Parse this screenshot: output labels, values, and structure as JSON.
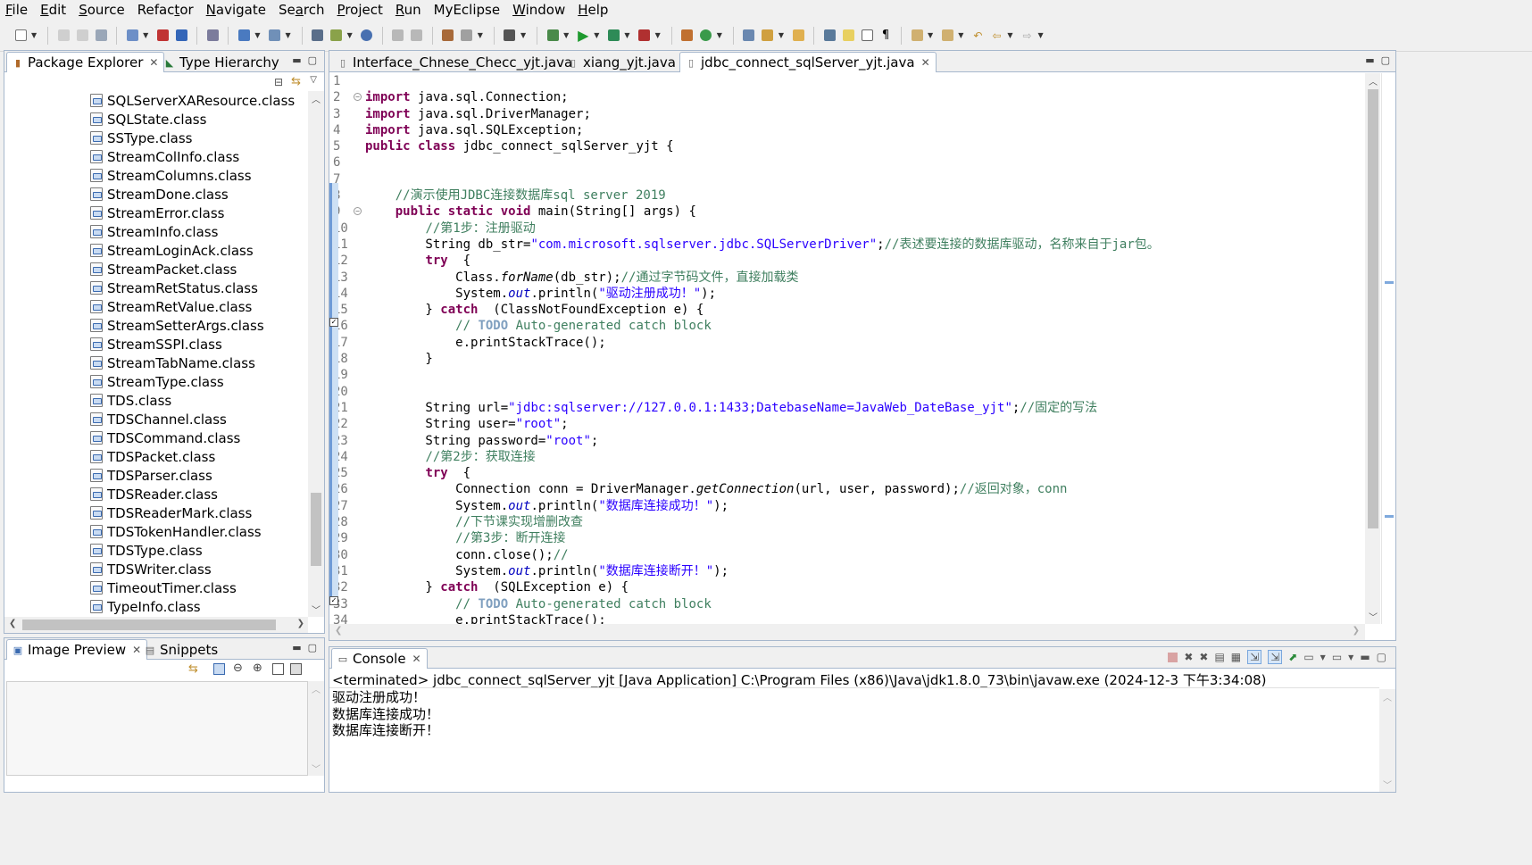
{
  "menu": [
    {
      "pre": "",
      "u": "F",
      "post": "ile"
    },
    {
      "pre": "",
      "u": "E",
      "post": "dit"
    },
    {
      "pre": "",
      "u": "S",
      "post": "ource"
    },
    {
      "pre": "Refac",
      "u": "t",
      "post": "or"
    },
    {
      "pre": "",
      "u": "N",
      "post": "avigate"
    },
    {
      "pre": "Se",
      "u": "a",
      "post": "rch"
    },
    {
      "pre": "",
      "u": "P",
      "post": "roject"
    },
    {
      "pre": "",
      "u": "R",
      "post": "un"
    },
    {
      "pre": "MyEclipse",
      "u": "",
      "post": ""
    },
    {
      "pre": "",
      "u": "W",
      "post": "indow"
    },
    {
      "pre": "",
      "u": "H",
      "post": "elp"
    }
  ],
  "package_explorer": {
    "tabs": [
      "Package Explorer",
      "Type Hierarchy"
    ],
    "items": [
      "SQLServerXAResource.class",
      "SQLState.class",
      "SSType.class",
      "StreamColInfo.class",
      "StreamColumns.class",
      "StreamDone.class",
      "StreamError.class",
      "StreamInfo.class",
      "StreamLoginAck.class",
      "StreamPacket.class",
      "StreamRetStatus.class",
      "StreamRetValue.class",
      "StreamSetterArgs.class",
      "StreamSSPI.class",
      "StreamTabName.class",
      "StreamType.class",
      "TDS.class",
      "TDSChannel.class",
      "TDSCommand.class",
      "TDSPacket.class",
      "TDSParser.class",
      "TDSReader.class",
      "TDSReaderMark.class",
      "TDSTokenHandler.class",
      "TDSType.class",
      "TDSWriter.class",
      "TimeoutTimer.class",
      "TypeInfo.class"
    ]
  },
  "image_preview": {
    "tabs": [
      "Image Preview",
      "Snippets"
    ]
  },
  "editor": {
    "tabs": [
      "Interface_Chnese_Checc_yjt.java",
      "xiang_yjt.java",
      "jdbc_connect_sqlServer_yjt.java"
    ],
    "active_tab": 2,
    "lines": [
      {
        "n": "1",
        "segs": []
      },
      {
        "n": "2",
        "segs": [
          [
            "kw",
            "import"
          ],
          [
            "",
            "java.sql.Connection;"
          ]
        ]
      },
      {
        "n": "3",
        "segs": [
          [
            "kw",
            "import"
          ],
          [
            "",
            "java.sql.DriverManager;"
          ]
        ]
      },
      {
        "n": "4",
        "segs": [
          [
            "kw",
            "import"
          ],
          [
            "",
            "java.sql.SQLException;"
          ]
        ]
      },
      {
        "n": "5",
        "segs": [
          [
            "kw",
            "public class"
          ],
          [
            "",
            "jdbc_connect_sqlServer_yjt {"
          ]
        ]
      },
      {
        "n": "6",
        "segs": []
      },
      {
        "n": "7",
        "segs": []
      },
      {
        "n": "8",
        "segs": [
          [
            "",
            "    "
          ],
          [
            "cm",
            "//演示使用JDBC连接数据库sql server 2019"
          ]
        ]
      },
      {
        "n": "9",
        "segs": [
          [
            "",
            "    "
          ],
          [
            "kw",
            "public static void"
          ],
          [
            "",
            "main(String[] args) {"
          ]
        ]
      },
      {
        "n": "10",
        "segs": [
          [
            "",
            "        "
          ],
          [
            "cm",
            "//第1步：注册驱动"
          ]
        ]
      },
      {
        "n": "11",
        "segs": [
          [
            "",
            "        String db_str="
          ],
          [
            "str",
            "\"com.microsoft.sqlserver.jdbc.SQLServerDriver\""
          ],
          [
            "",
            ";"
          ],
          [
            "cm",
            "//表述要连接的数据库驱动，名称来自于jar包。"
          ]
        ]
      },
      {
        "n": "12",
        "segs": [
          [
            "",
            "        "
          ],
          [
            "kw",
            "try"
          ],
          [
            "",
            " {"
          ]
        ]
      },
      {
        "n": "13",
        "segs": [
          [
            "",
            "            Class."
          ],
          [
            "itb",
            "forName"
          ],
          [
            "",
            "(db_str);"
          ],
          [
            "cm",
            "//通过字节码文件，直接加载类"
          ]
        ]
      },
      {
        "n": "14",
        "segs": [
          [
            "",
            "            System."
          ],
          [
            "it",
            "out"
          ],
          [
            "",
            ".println("
          ],
          [
            "str",
            "\"驱动注册成功！\""
          ],
          [
            "",
            ");"
          ]
        ]
      },
      {
        "n": "15",
        "segs": [
          [
            "",
            "        } "
          ],
          [
            "kw",
            "catch"
          ],
          [
            "",
            " (ClassNotFoundException e) {"
          ]
        ]
      },
      {
        "n": "16",
        "segs": [
          [
            "",
            "            "
          ],
          [
            "cm",
            "// "
          ],
          [
            "todo",
            "TODO"
          ],
          [
            "cm",
            " Auto-generated catch block"
          ]
        ]
      },
      {
        "n": "17",
        "segs": [
          [
            "",
            "            e.printStackTrace();"
          ]
        ]
      },
      {
        "n": "18",
        "segs": [
          [
            "",
            "        }"
          ]
        ]
      },
      {
        "n": "19",
        "segs": []
      },
      {
        "n": "20",
        "segs": []
      },
      {
        "n": "21",
        "segs": [
          [
            "",
            "        String url="
          ],
          [
            "str",
            "\"jdbc:sqlserver://127.0.0.1:1433;DatebaseName=JavaWeb_DateBase_yjt\""
          ],
          [
            "",
            ";"
          ],
          [
            "cm",
            "//固定的写法"
          ]
        ]
      },
      {
        "n": "22",
        "segs": [
          [
            "",
            "        String user="
          ],
          [
            "str",
            "\"root\""
          ],
          [
            "",
            ";"
          ]
        ]
      },
      {
        "n": "23",
        "segs": [
          [
            "",
            "        String password="
          ],
          [
            "str",
            "\"root\""
          ],
          [
            "",
            ";"
          ]
        ]
      },
      {
        "n": "24",
        "segs": [
          [
            "",
            "        "
          ],
          [
            "cm",
            "//第2步：获取连接"
          ]
        ]
      },
      {
        "n": "25",
        "segs": [
          [
            "",
            "        "
          ],
          [
            "kw",
            "try"
          ],
          [
            "",
            " {"
          ]
        ]
      },
      {
        "n": "26",
        "segs": [
          [
            "",
            "            Connection conn = DriverManager."
          ],
          [
            "itb",
            "getConnection"
          ],
          [
            "",
            "(url, user, password);"
          ],
          [
            "cm",
            "//返回对象，conn"
          ]
        ]
      },
      {
        "n": "27",
        "segs": [
          [
            "",
            "            System."
          ],
          [
            "it",
            "out"
          ],
          [
            "",
            ".println("
          ],
          [
            "str",
            "\"数据库连接成功！\""
          ],
          [
            "",
            ");"
          ]
        ]
      },
      {
        "n": "28",
        "segs": [
          [
            "",
            "            "
          ],
          [
            "cm",
            "//下节课实现增删改查"
          ]
        ]
      },
      {
        "n": "29",
        "segs": [
          [
            "",
            "            "
          ],
          [
            "cm",
            "//第3步：断开连接"
          ]
        ]
      },
      {
        "n": "30",
        "segs": [
          [
            "",
            "            conn.close();"
          ],
          [
            "cm",
            "//"
          ]
        ]
      },
      {
        "n": "31",
        "segs": [
          [
            "",
            "            System."
          ],
          [
            "it",
            "out"
          ],
          [
            "",
            ".println("
          ],
          [
            "str",
            "\"数据库连接断开！\""
          ],
          [
            "",
            ");"
          ]
        ]
      },
      {
        "n": "32",
        "segs": [
          [
            "",
            "        } "
          ],
          [
            "kw",
            "catch"
          ],
          [
            "",
            " (SQLException e) {"
          ]
        ]
      },
      {
        "n": "33",
        "segs": [
          [
            "",
            "            "
          ],
          [
            "cm",
            "// "
          ],
          [
            "todo",
            "TODO"
          ],
          [
            "cm",
            " Auto-generated catch block"
          ]
        ]
      },
      {
        "n": "34",
        "segs": [
          [
            "",
            "            e.printStackTrace();"
          ]
        ]
      }
    ]
  },
  "console": {
    "tab": "Console",
    "title": "<terminated> jdbc_connect_sqlServer_yjt [Java Application] C:\\Program Files (x86)\\Java\\jdk1.8.0_73\\bin\\javaw.exe (2024-12-3 下午3:34:08)",
    "output": [
      "驱动注册成功！",
      "数据库连接成功！",
      "数据库连接断开！"
    ]
  },
  "colors": {
    "keyword": "#7f0055",
    "comment": "#3f7f5f",
    "string": "#2a00ff",
    "field": "#0000c0",
    "panel_border": "#a7b8cd"
  }
}
